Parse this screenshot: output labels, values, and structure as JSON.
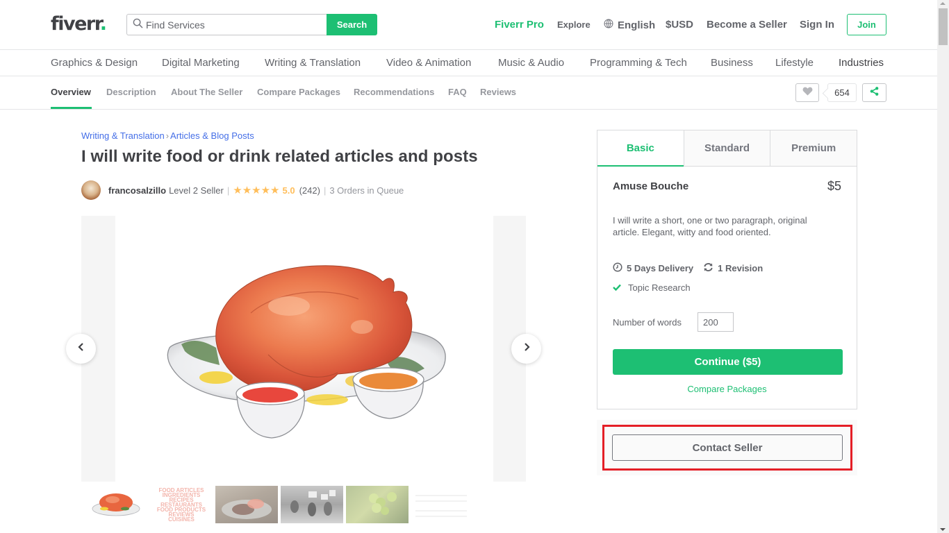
{
  "header": {
    "logo": "fiverr",
    "logo_dot": ".",
    "search": {
      "placeholder": "Find Services",
      "value": "",
      "button_label": "Search",
      "icon": "search-icon"
    },
    "nav": {
      "pro": "Fiverr Pro",
      "explore": "Explore",
      "language": "English",
      "language_icon": "globe-icon",
      "currency": "$USD",
      "become_seller": "Become a Seller",
      "sign_in": "Sign In",
      "join": "Join"
    }
  },
  "categories": [
    "Graphics & Design",
    "Digital Marketing",
    "Writing & Translation",
    "Video & Animation",
    "Music & Audio",
    "Programming & Tech",
    "Business",
    "Lifestyle",
    "Industries"
  ],
  "subnav": {
    "tabs": [
      "Overview",
      "Description",
      "About The Seller",
      "Compare Packages",
      "Recommendations",
      "FAQ",
      "Reviews"
    ],
    "active": "Overview",
    "favorite_icon": "heart-icon",
    "favorites_count": "654",
    "share_icon": "share-icon"
  },
  "gig": {
    "breadcrumb": [
      "Writing & Translation",
      "Articles & Blog Posts"
    ],
    "breadcrumb_separator": "›",
    "title": "I will write food or drink related articles and posts",
    "seller": {
      "name": "francosalzillo",
      "level": "Level 2 Seller",
      "stars": "★★★★★",
      "star_rating": 5,
      "rating": "5.0",
      "reviews": "(242)",
      "queue": "3 Orders in Queue"
    },
    "gallery": {
      "main_image": "Watercolor roast turkey on a platter with two dipping sauces",
      "prev_icon": "chevron-left-icon",
      "next_icon": "chevron-right-icon",
      "thumbnails": [
        "Roast turkey illustration",
        "Food articles text graphic",
        "Steak and lobster plate",
        "Vintage protest photo",
        "Grapes on the vine",
        "Faded text document"
      ],
      "thumbnail_text": [
        "FOOD ARTICLES",
        "INGREDIENTS",
        "RECIPES",
        "RESTAURANTS",
        "FOOD PRODUCTS",
        "REVIEWS",
        "CUISINES"
      ]
    }
  },
  "packages": {
    "tabs": [
      "Basic",
      "Standard",
      "Premium"
    ],
    "active": "Basic",
    "name": "Amuse Bouche",
    "price": "$5",
    "description": "I will write a short, one or two paragraph, original article. Elegant, witty and food oriented.",
    "delivery": "5 Days Delivery",
    "delivery_icon": "clock-icon",
    "revisions": "1 Revision",
    "revisions_icon": "refresh-icon",
    "features": [
      "Topic Research"
    ],
    "feature_icon": "check-icon",
    "words_label": "Number of words",
    "words_value": "200",
    "continue_label": "Continue ($5)",
    "compare_label": "Compare Packages",
    "contact_label": "Contact Seller"
  },
  "colors": {
    "brand_green": "#1dbf73",
    "text_dark": "#404145",
    "text_gray": "#62646a",
    "link_blue": "#446ee7",
    "star_yellow": "#ffbe5b",
    "highlight_red": "#e41e26"
  }
}
